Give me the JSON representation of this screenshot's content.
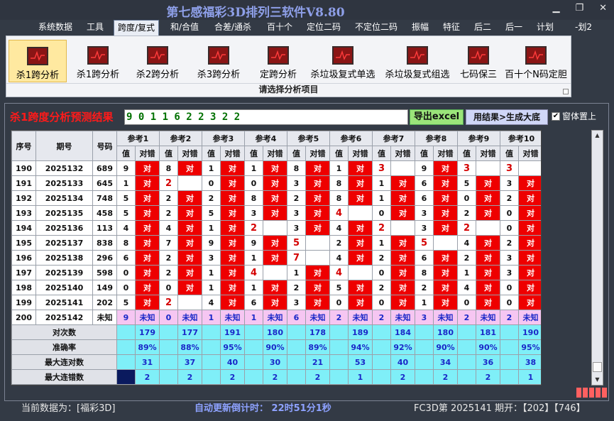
{
  "app": {
    "title": "第七感福彩3D排列三软件V8.80"
  },
  "menu": [
    "系统数据",
    "工具",
    "跨度/复式",
    "和/合值",
    "合差/通杀",
    "百十个",
    "定位二码",
    "不定位二码",
    "振幅",
    "特征",
    "后二",
    "后一",
    "计划",
    "-划2"
  ],
  "ribbon": {
    "buttons": [
      "杀1跨分析",
      "杀1跨分析",
      "杀2跨分析",
      "杀3跨分析",
      "定跨分析",
      "杀垃圾复式单选",
      "杀垃圾复式组选",
      "七码保三",
      "百十个N码定胆"
    ],
    "footer": "请选择分析项目"
  },
  "panel": {
    "headline": "杀1跨度分析预测结果",
    "result": "9 0 1 1 6 2 2 3 2 2",
    "excel_label": "导出excel",
    "gen_label": "用结果>生成大底",
    "ontop_label": "窗体置上"
  },
  "table": {
    "col_seq": "序号",
    "col_issue": "期号",
    "col_num": "号码",
    "ref_headers": [
      "参考1",
      "参考2",
      "参考3",
      "参考4",
      "参考5",
      "参考6",
      "参考7",
      "参考8",
      "参考9",
      "参考10"
    ],
    "val_label": "值",
    "hit_label": "对错",
    "rows": [
      {
        "seq": "190",
        "issue": "2025132",
        "num": "689",
        "vals": [
          "9",
          "8",
          "1",
          "1",
          "8",
          "1",
          "3",
          "9",
          "3",
          "3"
        ],
        "hits": [
          "对",
          "对",
          "对",
          "对",
          "对",
          "对",
          "",
          "对",
          "",
          ""
        ]
      },
      {
        "seq": "191",
        "issue": "2025133",
        "num": "645",
        "vals": [
          "1",
          "2",
          "0",
          "0",
          "3",
          "8",
          "1",
          "6",
          "5",
          "3"
        ],
        "hits": [
          "对",
          "",
          "对",
          "对",
          "对",
          "对",
          "对",
          "对",
          "对",
          "对"
        ]
      },
      {
        "seq": "192",
        "issue": "2025134",
        "num": "748",
        "vals": [
          "5",
          "2",
          "2",
          "8",
          "2",
          "8",
          "1",
          "6",
          "0",
          "2"
        ],
        "hits": [
          "对",
          "对",
          "对",
          "对",
          "对",
          "对",
          "对",
          "对",
          "对",
          "对"
        ]
      },
      {
        "seq": "193",
        "issue": "2025135",
        "num": "458",
        "vals": [
          "5",
          "2",
          "5",
          "3",
          "3",
          "4",
          "0",
          "3",
          "2",
          "0"
        ],
        "hits": [
          "对",
          "对",
          "对",
          "对",
          "对",
          "",
          "对",
          "对",
          "对",
          "对"
        ]
      },
      {
        "seq": "194",
        "issue": "2025136",
        "num": "113",
        "vals": [
          "4",
          "4",
          "1",
          "2",
          "3",
          "4",
          "2",
          "3",
          "2",
          "0"
        ],
        "hits": [
          "对",
          "对",
          "对",
          "",
          "对",
          "对",
          "",
          "对",
          "",
          "对"
        ]
      },
      {
        "seq": "195",
        "issue": "2025137",
        "num": "838",
        "vals": [
          "8",
          "7",
          "9",
          "9",
          "5",
          "2",
          "1",
          "5",
          "4",
          "2"
        ],
        "hits": [
          "对",
          "对",
          "对",
          "对",
          "",
          "对",
          "对",
          "",
          "对",
          "对"
        ]
      },
      {
        "seq": "196",
        "issue": "2025138",
        "num": "296",
        "vals": [
          "6",
          "2",
          "3",
          "1",
          "7",
          "4",
          "2",
          "6",
          "2",
          "3"
        ],
        "hits": [
          "对",
          "对",
          "对",
          "对",
          "",
          "对",
          "对",
          "对",
          "对",
          "对"
        ]
      },
      {
        "seq": "197",
        "issue": "2025139",
        "num": "598",
        "vals": [
          "0",
          "2",
          "1",
          "4",
          "1",
          "4",
          "0",
          "8",
          "1",
          "3"
        ],
        "hits": [
          "对",
          "对",
          "对",
          "",
          "对",
          "",
          "对",
          "对",
          "对",
          "对"
        ]
      },
      {
        "seq": "198",
        "issue": "2025140",
        "num": "149",
        "vals": [
          "0",
          "0",
          "1",
          "1",
          "2",
          "5",
          "2",
          "2",
          "4",
          "0"
        ],
        "hits": [
          "对",
          "对",
          "对",
          "对",
          "对",
          "对",
          "对",
          "对",
          "对",
          "对"
        ]
      },
      {
        "seq": "199",
        "issue": "2025141",
        "num": "202",
        "vals": [
          "5",
          "2",
          "4",
          "6",
          "3",
          "0",
          "0",
          "1",
          "0",
          "0"
        ],
        "hits": [
          "对",
          "",
          "对",
          "对",
          "对",
          "对",
          "对",
          "对",
          "对",
          "对"
        ]
      },
      {
        "seq": "200",
        "issue": "2025142",
        "num": "未知",
        "vals": [
          "9",
          "0",
          "1",
          "1",
          "6",
          "2",
          "2",
          "3",
          "2",
          "2"
        ],
        "hits": [
          "未知",
          "未知",
          "未知",
          "未知",
          "未知",
          "未知",
          "未知",
          "未知",
          "未知",
          "未知"
        ]
      }
    ],
    "stats": [
      {
        "label": "对次数",
        "values": [
          "179",
          "177",
          "191",
          "180",
          "178",
          "189",
          "184",
          "180",
          "181",
          "190"
        ]
      },
      {
        "label": "准确率",
        "values": [
          "89%",
          "88%",
          "95%",
          "90%",
          "89%",
          "94%",
          "92%",
          "90%",
          "90%",
          "95%"
        ]
      },
      {
        "label": "最大连对数",
        "values": [
          "31",
          "37",
          "40",
          "30",
          "21",
          "53",
          "40",
          "34",
          "36",
          "38"
        ]
      },
      {
        "label": "最大连错数",
        "values": [
          "2",
          "2",
          "2",
          "2",
          "2",
          "1",
          "2",
          "2",
          "2",
          "1"
        ]
      }
    ]
  },
  "status": {
    "left": "当前数据为：[福彩3D]",
    "mid": "自动更新倒计时： 22时51分1秒",
    "right": "FC3D第 2025141 期开：【202】【746】"
  },
  "colors": {
    "hit": "#ee0000",
    "pending_row": "#f6c6f2",
    "stat": "#7feff8",
    "title": "#8e9fe8",
    "headline": "#ff1a1a"
  }
}
